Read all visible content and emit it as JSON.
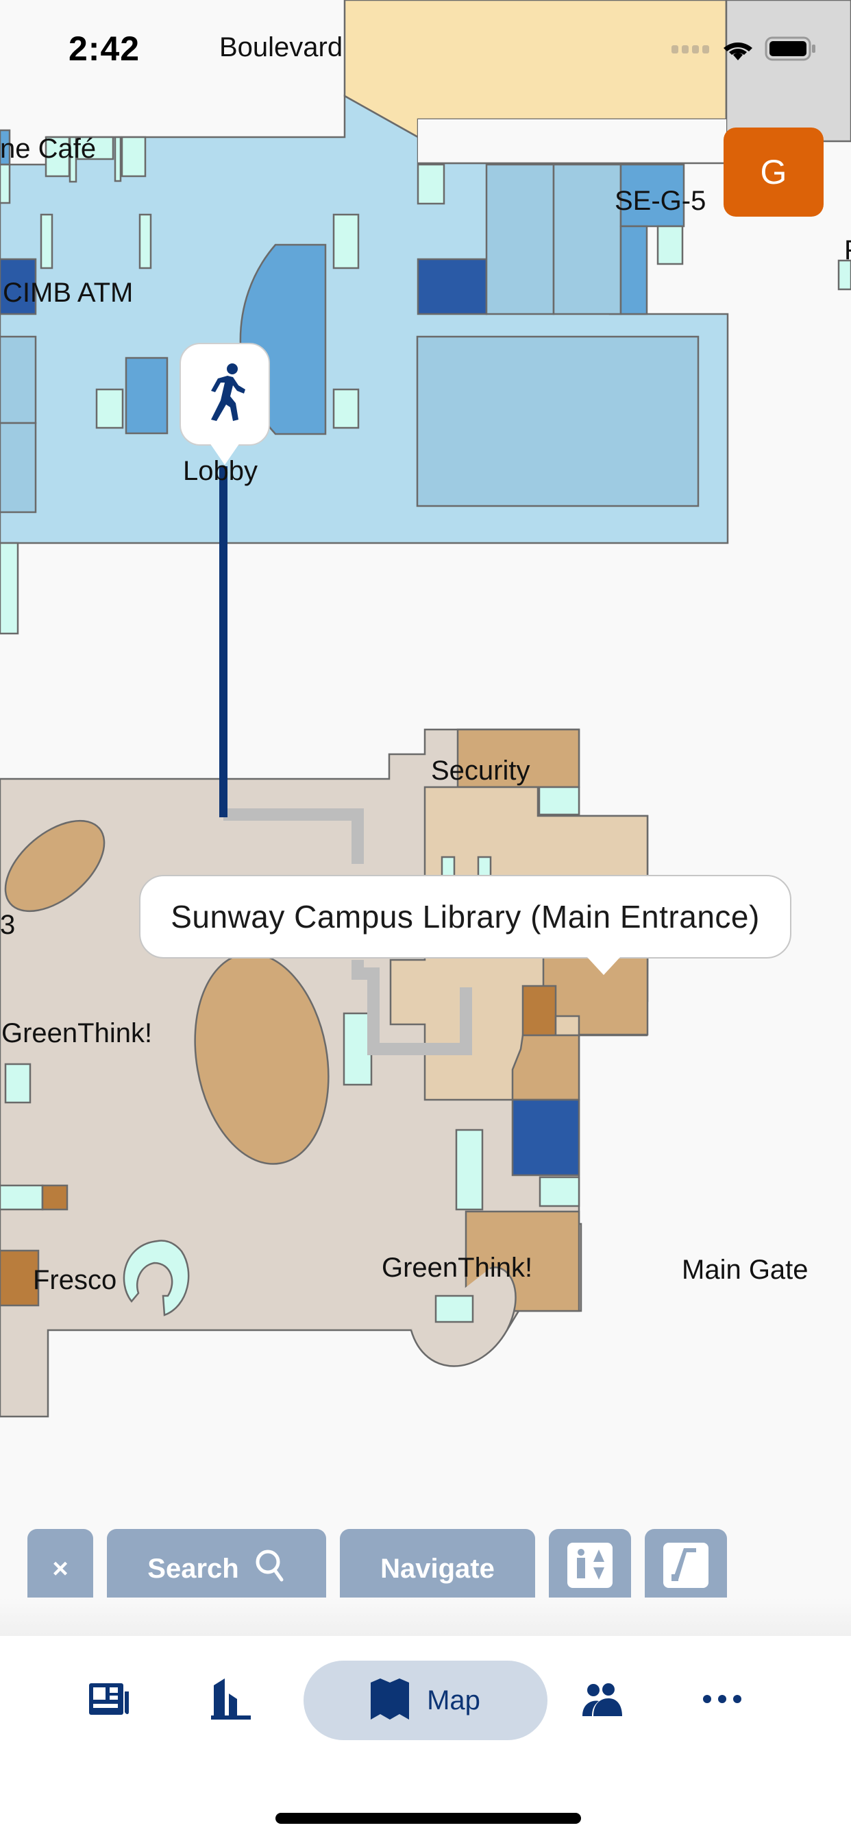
{
  "status_bar": {
    "time": "2:42",
    "wifi_icon": "wifi-icon",
    "battery_icon": "battery-icon",
    "signal_icon": "cellular-signal-icon"
  },
  "map": {
    "labels": {
      "boulevard": "Boulevard",
      "cafe": "ne Café",
      "cimb_atm": "CIMB ATM",
      "se_g_5": "SE-G-5",
      "lobby": "Lobby",
      "security": "Security",
      "three": "3",
      "greenthink_left": "GreenThink!",
      "greenthink_bottom": "GreenThink!",
      "fresco": "Fresco",
      "main_gate": "Main Gate",
      "edge_p": "F"
    },
    "start_marker_icon": "walking-person-icon",
    "route_color": "#0c3475",
    "callout": {
      "text": "Sunway Campus Library (Main Entrance)"
    },
    "floor_button": {
      "label": "G",
      "color": "#dc6208"
    }
  },
  "toolbar": {
    "close_label": "×",
    "search_label": "Search",
    "navigate_label": "Navigate",
    "elevator_icon": "elevator-icon",
    "escalator_icon": "escalator-icon"
  },
  "tabbar": {
    "tabs": [
      {
        "icon": "newspaper-icon",
        "label": ""
      },
      {
        "icon": "building-icon",
        "label": ""
      },
      {
        "icon": "map-icon",
        "label": "Map",
        "active": true
      },
      {
        "icon": "people-icon",
        "label": ""
      },
      {
        "icon": "more-icon",
        "label": ""
      }
    ]
  }
}
